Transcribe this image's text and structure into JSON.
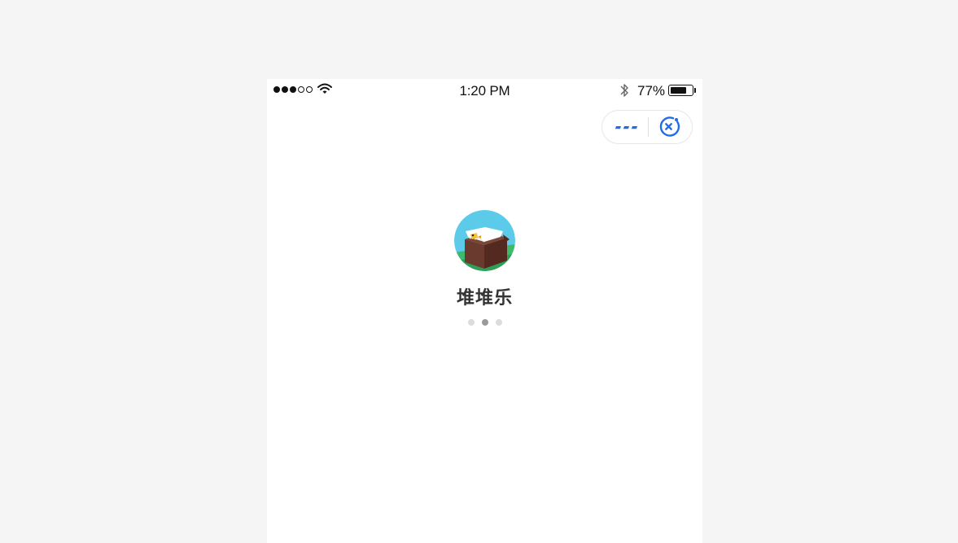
{
  "status_bar": {
    "time": "1:20 PM",
    "battery_percent_label": "77%",
    "battery_level": 0.77,
    "signal_bars_filled": 3,
    "signal_bars_total": 5
  },
  "capsule": {
    "more_icon": "more-dots-icon",
    "close_icon": "close-circle-icon",
    "accent_color": "#1e6cf2"
  },
  "app": {
    "name": "堆堆乐",
    "icon": "eagle-app-icon"
  },
  "loading": {
    "dot_count": 3,
    "active_index": 1
  }
}
